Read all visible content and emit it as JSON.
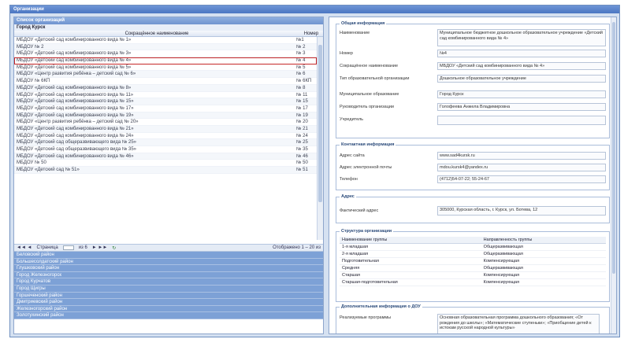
{
  "window": {
    "title": "Организации"
  },
  "list": {
    "header": "Список организаций",
    "group": "Город Курск",
    "columns": [
      "Сокращённое наименование",
      "Номер"
    ],
    "rows": [
      {
        "name": "МБДОУ «Детский сад комбинированного вида № 1»",
        "num": "№1"
      },
      {
        "name": "МБДОУ № 2",
        "num": "№ 2"
      },
      {
        "name": "МБДОУ «Детский сад комбинированного вида № 3»",
        "num": "№ 3"
      },
      {
        "name": "МБДОУ «Детский сад комбинированного вида № 4»",
        "num": "№ 4"
      },
      {
        "name": "МБДОУ «Детский сад комбинированного вида № 5»",
        "num": "№ 5"
      },
      {
        "name": "МБДОУ «Центр развития ребёнка – детский сад № 6»",
        "num": "№ 6"
      },
      {
        "name": "МБДОУ № 6КП",
        "num": "№ 6КП"
      },
      {
        "name": "МБДОУ «Детский сад комбинированного вида № 8»",
        "num": "№ 8"
      },
      {
        "name": "МБДОУ «Детский сад комбинированного вида № 11»",
        "num": "№ 11"
      },
      {
        "name": "МБДОУ «Детский сад комбинированного вида № 15»",
        "num": "№ 15"
      },
      {
        "name": "МБДОУ «Детский сад комбинированного вида № 17»",
        "num": "№ 17"
      },
      {
        "name": "МБДОУ «Детский сад комбинированного вида № 19»",
        "num": "№ 19"
      },
      {
        "name": "МБДОУ «Центр развития ребёнка – детский сад № 20»",
        "num": "№ 20"
      },
      {
        "name": "МБДОУ «Детский сад комбинированного вида № 21»",
        "num": "№ 21"
      },
      {
        "name": "МБДОУ «Детский сад комбинированного вида № 24»",
        "num": "№ 24"
      },
      {
        "name": "МБДОУ «Детский сад общеразвивающего вида № 25»",
        "num": "№ 25"
      },
      {
        "name": "МБДОУ «Детский сад общеразвивающего вида № 35»",
        "num": "№ 35"
      },
      {
        "name": "МБДОУ «Детский сад комбинированного вида № 46»",
        "num": "№ 46"
      },
      {
        "name": "МБДОУ № 50",
        "num": "№ 50"
      },
      {
        "name": "МБДОУ «Детский сад № 51»",
        "num": "№ 51"
      }
    ],
    "selected_index": 3,
    "pager": {
      "prev": "◄◄ ◄",
      "page_label": "Страница",
      "of": "из 6",
      "next": "► ►►",
      "refresh": "↻",
      "status": "Отображено 1 – 20 из"
    }
  },
  "districts": [
    "Беловский район",
    "Большесолдатский район",
    "Глушковский район",
    "Город Железногорск",
    "Город Курчатов",
    "Город Щигры",
    "Горшеченский район",
    "Дмитриевский район",
    "Железногорский район",
    "Золотухинский район"
  ],
  "details": {
    "general": {
      "legend": "Общая информация",
      "name_label": "Наименование",
      "name_value": "Муниципальное бюджетное дошкольное образовательное учреждение «Детский сад комбинированного вида № 4»",
      "number_label": "Номер",
      "number_value": "№4",
      "short_label": "Сокращённое наименование",
      "short_value": "МБДОУ «Детский сад комбинированного вида № 4»",
      "type_label": "Тип образовательной организации",
      "type_value": "Дошкольное образовательное учреждение",
      "mun_label": "Муниципальное образование",
      "mun_value": "Город Курск",
      "head_label": "Руководитель организации",
      "head_value": "Голофеева Анжела Владимировна",
      "founder_label": "Учредитель",
      "founder_value": ""
    },
    "contact": {
      "legend": "Контактная информация",
      "site_label": "Адрес сайта",
      "site_value": "www.sad4kursk.ru",
      "email_label": "Адрес электронной почты",
      "email_value": "mdou.kursk4@yandex.ru",
      "phone_label": "Телефон",
      "phone_value": "(4712)54-07-22; 55-24-67"
    },
    "address": {
      "legend": "Адрес",
      "label": "Фактический адрес",
      "value": "305000, Курская область, г. Курск, ул. Ботева, 12"
    },
    "groups": {
      "legend": "Структура организации",
      "col1": "Наименование группы",
      "col2": "Направленность группы",
      "rows": [
        [
          "1-я младшая",
          "Общеразвивающая"
        ],
        [
          "2-я младшая",
          "Общеразвивающая"
        ],
        [
          "Подготовительная",
          "Компенсирующая"
        ],
        [
          "Средняя",
          "Общеразвивающая"
        ],
        [
          "Старшая",
          "Компенсирующая"
        ],
        [
          "Старшая-подготовительная",
          "Компенсирующая"
        ]
      ]
    },
    "extra": {
      "legend": "Дополнительная информация о ДОУ",
      "label": "Реализуемые программы",
      "value": "Основная образовательная программа дошкольного образования; «От рождения до школы»; «Математические ступеньки»; «Приобщение детей к истокам русской народной культуры»"
    }
  }
}
